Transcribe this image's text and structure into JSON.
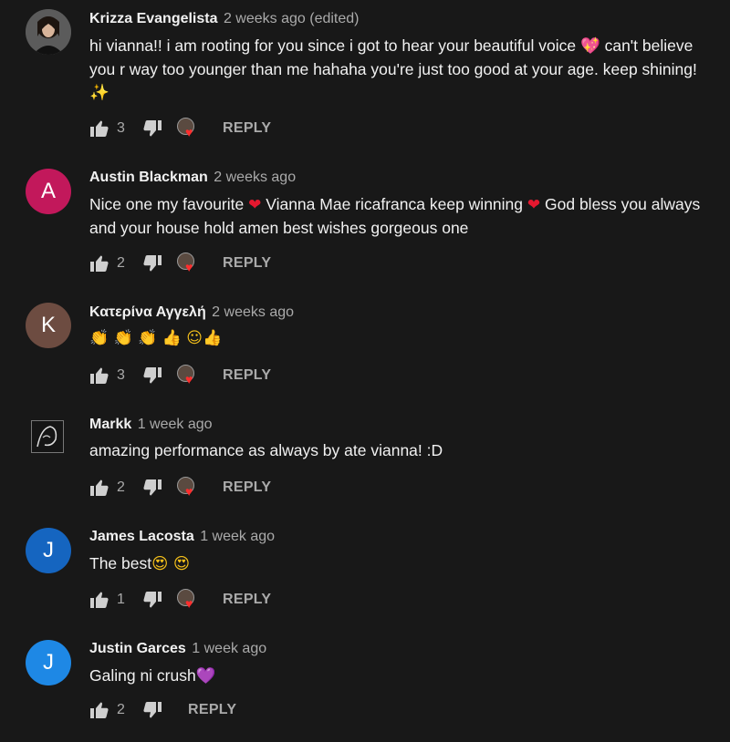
{
  "reply_label": "REPLY",
  "comments": [
    {
      "author": "Krizza Evangelista",
      "time": "2 weeks ago (edited)",
      "text_1": "hi vianna!! i am rooting for you since i got to hear your beautiful voice ",
      "emoji_1": "💖",
      "text_2": "  can't believe you r way too younger than me hahaha you're just too good at your age. keep shining! ",
      "emoji_2": "✨",
      "likes": "3"
    },
    {
      "author": "Austin Blackman",
      "time": "2 weeks ago",
      "avatar_letter": "A",
      "avatar_color": "#c2185b",
      "text_1": "Nice one my favourite ",
      "emoji_1": "❤",
      "text_2": "  Vianna Mae ricafranca keep winning ",
      "emoji_2": "❤",
      "text_3": "  God bless you always and your house hold amen best wishes gorgeous one",
      "likes": "2"
    },
    {
      "author": "Κατερίνα Αγγελή",
      "time": "2 weeks ago",
      "avatar_letter": "K",
      "avatar_color": "#6d4c41",
      "emojis": "👏 👏 👏 👍 ☺👍",
      "likes": "3"
    },
    {
      "author": "Markk",
      "time": "1 week ago",
      "text": "amazing performance as always by ate vianna! :D",
      "likes": "2"
    },
    {
      "author": "James Lacosta",
      "time": "1 week ago",
      "avatar_letter": "J",
      "avatar_color": "#1565c0",
      "text_1": "The best",
      "emoji_1": "😍 😍",
      "likes": "1"
    },
    {
      "author": "Justin Garces",
      "time": "1 week ago",
      "avatar_letter": "J",
      "avatar_color": "#1e88e5",
      "text_1": "Galing ni crush",
      "emoji_1": "💜",
      "likes": "2"
    }
  ]
}
